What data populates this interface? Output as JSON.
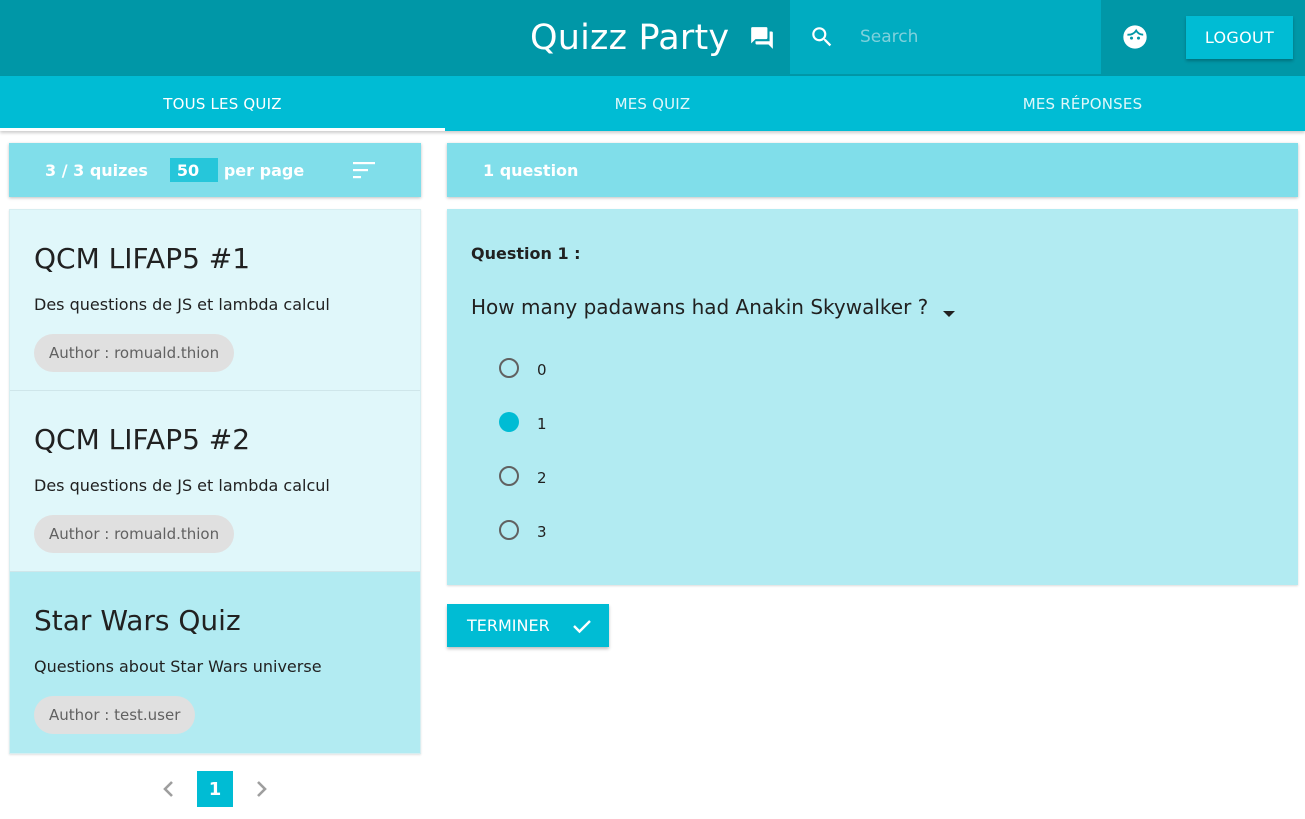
{
  "header": {
    "title": "Quizz Party",
    "search_placeholder": "Search",
    "logout_label": "LOGOUT"
  },
  "tabs": [
    {
      "label": "TOUS LES QUIZ",
      "active": true
    },
    {
      "label": "MES QUIZ",
      "active": false
    },
    {
      "label": "MES RÉPONSES",
      "active": false
    }
  ],
  "list_header": {
    "count_text": "3 / 3 quizes",
    "per_page_value": "50",
    "per_page_label": "per page"
  },
  "quizzes": [
    {
      "title": "QCM LIFAP5 #1",
      "description": "Des questions de JS et lambda calcul",
      "author": "Author : romuald.thion",
      "selected": false
    },
    {
      "title": "QCM LIFAP5 #2",
      "description": "Des questions de JS et lambda calcul",
      "author": "Author : romuald.thion",
      "selected": false
    },
    {
      "title": "Star Wars Quiz",
      "description": "Questions about Star Wars universe",
      "author": "Author : test.user",
      "selected": true
    }
  ],
  "pagination": {
    "current_page": "1"
  },
  "question_panel": {
    "header": "1 question",
    "question_label": "Question 1 :",
    "question_text": "How many padawans had Anakin Skywalker ?",
    "options": [
      {
        "label": "0",
        "checked": false
      },
      {
        "label": "1",
        "checked": true
      },
      {
        "label": "2",
        "checked": false
      },
      {
        "label": "3",
        "checked": false
      }
    ],
    "finish_label": "TERMINER"
  },
  "colors": {
    "header_bg": "#0097a7",
    "accent": "#00bcd4",
    "panel_header": "#80deea",
    "card_light": "#e0f7fa",
    "card_selected": "#b2ebf2"
  }
}
